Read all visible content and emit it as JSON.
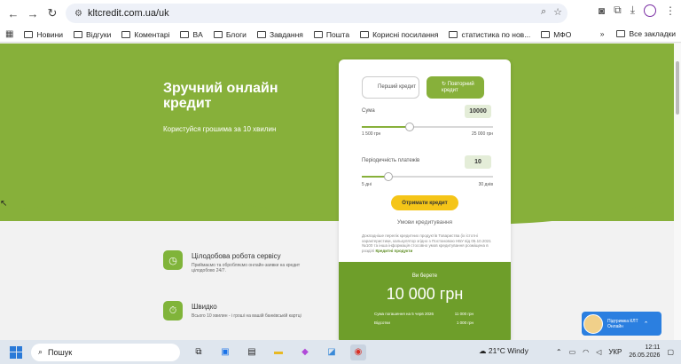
{
  "browser": {
    "url": "kltcredit.com.ua/uk",
    "bookmarks": [
      "Новини",
      "Відгуки",
      "Коментарі",
      "BA",
      "Блоги",
      "Завдання",
      "Пошта",
      "Корисні посилання",
      "статистика по нов...",
      "МФО"
    ],
    "all_bookmarks": "Все закладки"
  },
  "hero": {
    "title": "Зручний онлайн кредит",
    "subtitle": "Користуйся грошима за 10 хвилин"
  },
  "calculator": {
    "tab_first": "Перший кредит",
    "tab_second": "↻ Повторний кредит",
    "amount_label": "Сума",
    "amount_value": "10000",
    "amount_min": "1 500 грн",
    "amount_max": "25 000 грн",
    "amount_fraction": 0.365,
    "period_label": "Періодичність платежів",
    "period_value": "10",
    "period_min": "5 дні",
    "period_max": "30 днів",
    "period_fraction": 0.2,
    "get_button": "Отримати кредит",
    "terms_link": "Умови кредитування",
    "fine_print": "Докладніше перелік кредитних продуктів Товариства (іх істотні характеристики, калькулятор згідно з Постановою НБУ від 05.10.2021 №100 та інша інформація стосовно умов кредитування розміщена в розділі",
    "fine_link": "Кредитні продукти"
  },
  "summary": {
    "you_take": "Ви берете",
    "amount": "10 000 грн",
    "row1_label": "Сума погашення на 5 черв 2026",
    "row1_value": "11 000 грн",
    "row2_label": "Відсотки",
    "row2_value": "1 000 грн"
  },
  "features": [
    {
      "title": "Цілодобова робота сервісу",
      "desc": "Приймаємо та обробляємо онлайн-заявки на кредит цілодобово 24/7."
    },
    {
      "title": "Швидко",
      "desc": "Всього 10 хвилин - і гроші на вашій банківській картці"
    }
  ],
  "support": {
    "title": "Підтримка КЛТ",
    "subtitle": "Онлайн"
  },
  "taskbar": {
    "search": "Пошук",
    "weather": "21°C  Windy",
    "lang": "УКР",
    "time": "12:11",
    "date": "26.05.2026"
  }
}
